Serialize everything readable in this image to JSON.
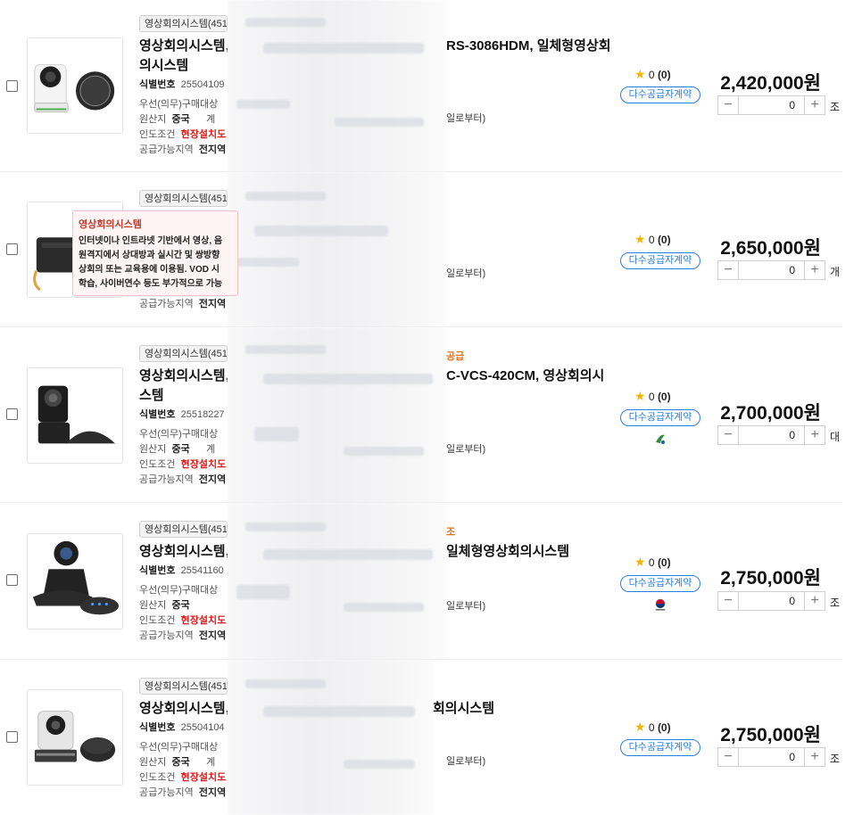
{
  "colors": {
    "accent": "#2a7de1",
    "price_red": "#e01b1b",
    "star": "#f4b400"
  },
  "labels": {
    "id_label": "식별번호",
    "preferred": "우선(의무)구매대상",
    "origin_label": "원산지",
    "delivery_label": "인도조건",
    "region_label": "공급가능지역",
    "from_suffix": "일로부터)"
  },
  "products": [
    {
      "category": "영상회의시스템(451",
      "title_left": "영상회의시스템,",
      "title_right": "RS-3086HDM, 일체형영상회",
      "title_line2": "의시스템",
      "id_value": "25504109",
      "origin": "중국",
      "origin_extra": "계",
      "delivery": "현장설치도",
      "region": "전지역",
      "rating": "0",
      "reviews": "(0)",
      "contract": "다수공급자계약",
      "price": "2,420,000원",
      "qty": "0",
      "unit": "조"
    },
    {
      "category": "영상회의시스템(451",
      "tooltip_title": "영상회의시스템",
      "tooltip_lines": [
        "인터넷이나 인트라넷 기반에서 영상, 음",
        "원격지에서 상대방과 실시간 및 쌍방향",
        "상회의 또는 교육용에 이용됨. VOD 시",
        "학습, 사이버연수 등도 부가적으로 가능"
      ],
      "region": "전지역",
      "rating": "0",
      "reviews": "(0)",
      "contract": "다수공급자계약",
      "price": "2,650,000원",
      "qty": "0",
      "unit": "개"
    },
    {
      "category": "영상회의시스템(451",
      "tag_right": "공급",
      "title_left": "영상회의시스템,",
      "title_right": "C-VCS-420CM, 영상회의시",
      "title_line2": "스템",
      "id_value": "25518227",
      "origin": "중국",
      "origin_extra": "계",
      "delivery": "현장설치도",
      "region": "전지역",
      "rating": "0",
      "reviews": "(0)",
      "contract": "다수공급자계약",
      "price": "2,700,000원",
      "qty": "0",
      "unit": "대"
    },
    {
      "category": "영상회의시스템(451",
      "tag_right": "조",
      "title_left": "영상회의시스템,",
      "title_right": "일체형영상회의시스템",
      "id_value": "25541160",
      "origin": "중국",
      "delivery": "현장설치도",
      "region": "전지역",
      "rating": "0",
      "reviews": "(0)",
      "contract": "다수공급자계약",
      "price": "2,750,000원",
      "qty": "0",
      "unit": "조"
    },
    {
      "category": "영상회의시스템(451",
      "title_left": "영상회의시스템,",
      "title_right": "회의시스템",
      "id_value": "25504104",
      "origin": "중국",
      "origin_extra": "계",
      "delivery": "현장설치도",
      "region": "전지역",
      "rating": "0",
      "reviews": "(0)",
      "contract": "다수공급자계약",
      "price": "2,750,000원",
      "qty": "0",
      "unit": "조"
    }
  ]
}
